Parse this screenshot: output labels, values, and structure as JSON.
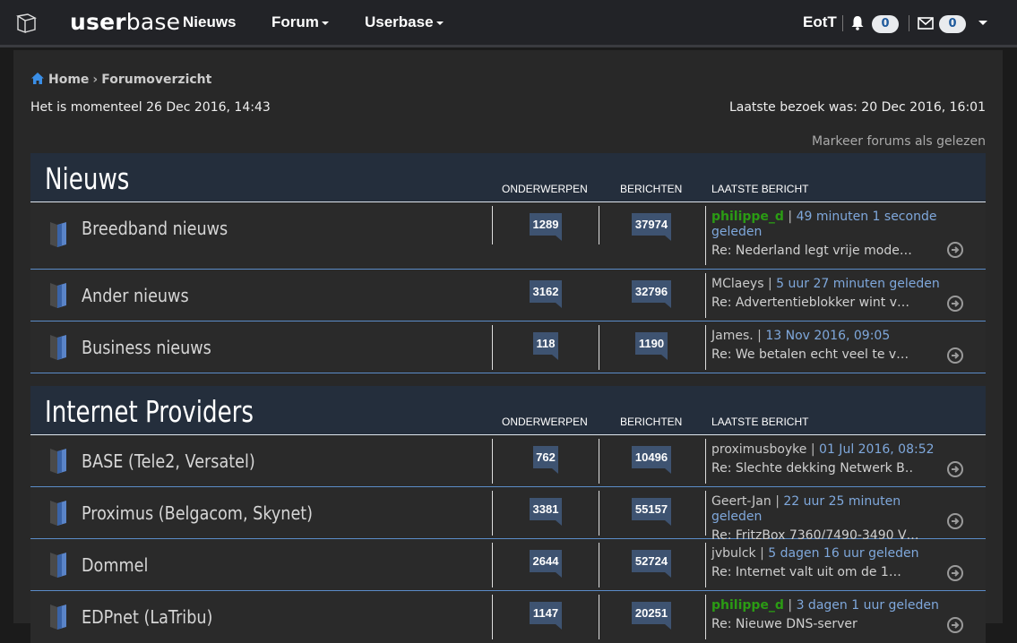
{
  "topbar": {
    "logo_bold": "user",
    "logo_light": "base",
    "nav": [
      {
        "label": "Nieuws",
        "caret": false
      },
      {
        "label": "Forum",
        "caret": true
      },
      {
        "label": "Userbase",
        "caret": true
      }
    ],
    "username": "EotT",
    "notifications_count": "0",
    "messages_count": "0"
  },
  "breadcrumb": {
    "home": "Home",
    "current": "Forumoverzicht"
  },
  "info": {
    "current_time": "Het is momenteel 26 Dec 2016, 14:43",
    "last_visit": "Laatste bezoek was: 20 Dec 2016, 16:01",
    "mark_read": "Markeer forums als gelezen"
  },
  "columns": {
    "topics": "ONDERWERPEN",
    "posts": "BERICHTEN",
    "last_post": "LAATSTE BERICHT"
  },
  "categories": [
    {
      "title": "Nieuws",
      "forums": [
        {
          "name": "Breedband nieuws",
          "topics": "1289",
          "posts": "37974",
          "last_user": "philippe_d",
          "last_user_green": true,
          "last_time": "49 minuten 1 seconde geleden",
          "last_subject": "Re: Nederland legt vrije mode…"
        },
        {
          "name": "Ander nieuws",
          "topics": "3162",
          "posts": "32796",
          "last_user": "MClaeys",
          "last_user_green": false,
          "last_time": "5 uur 27 minuten geleden",
          "last_subject": "Re: Advertentieblokker wint v…"
        },
        {
          "name": "Business nieuws",
          "topics": "118",
          "posts": "1190",
          "last_user": "James.",
          "last_user_green": false,
          "last_time": "13 Nov 2016, 09:05",
          "last_subject": "Re: We betalen echt veel te v…"
        }
      ]
    },
    {
      "title": "Internet Providers",
      "forums": [
        {
          "name": "BASE (Tele2, Versatel)",
          "topics": "762",
          "posts": "10496",
          "last_user": "proximusboyke",
          "last_user_green": false,
          "last_time": "01 Jul 2016, 08:52",
          "last_subject": "Re: Slechte dekking Netwerk B…"
        },
        {
          "name": "Proximus (Belgacom, Skynet)",
          "topics": "3381",
          "posts": "55157",
          "last_user": "Geert-Jan",
          "last_user_green": false,
          "last_time": "22 uur 25 minuten geleden",
          "last_subject": "Re: FritzBox 7360/7490-3490 V…"
        },
        {
          "name": "Dommel",
          "topics": "2644",
          "posts": "52724",
          "last_user": "jvbulck",
          "last_user_green": false,
          "last_time": "5 dagen 16 uur geleden",
          "last_subject": "Re: Internet valt uit om de 1…"
        },
        {
          "name": "EDPnet (LaTribu)",
          "topics": "1147",
          "posts": "20251",
          "last_user": "philippe_d",
          "last_user_green": true,
          "last_time": "3 dagen 1 uur geleden",
          "last_subject": "Re: Nieuwe DNS-server"
        }
      ]
    }
  ]
}
